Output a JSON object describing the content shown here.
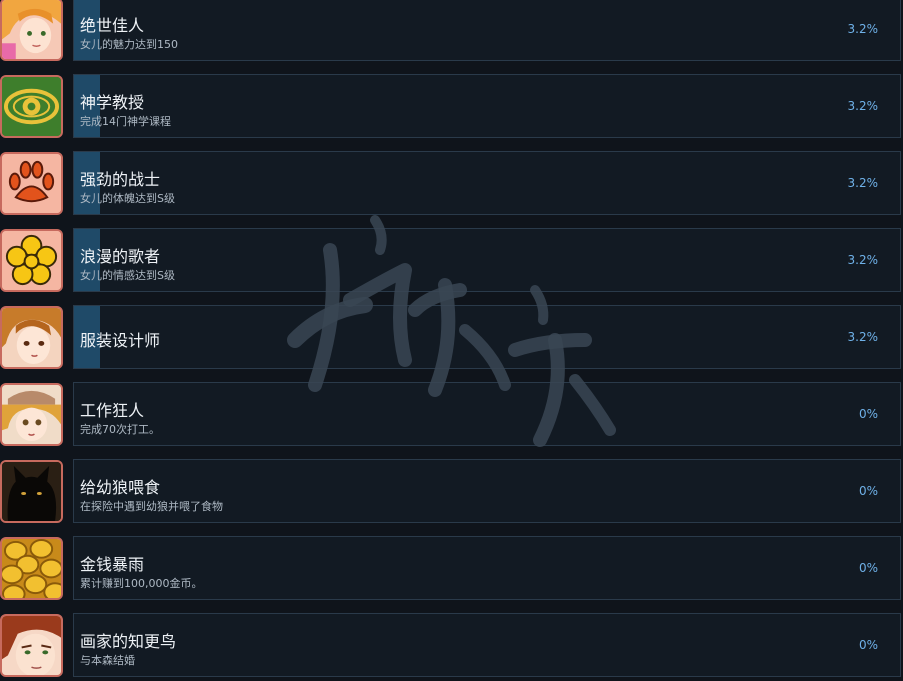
{
  "achievements": [
    {
      "title": "绝世佳人",
      "desc": "女儿的魅力达到150",
      "percent": "3.2%",
      "progress": 0.032,
      "icon": "blonde-girl-icon"
    },
    {
      "title": "神学教授",
      "desc": "完成14门神学课程",
      "percent": "3.2%",
      "progress": 0.032,
      "icon": "eye-icon"
    },
    {
      "title": "强劲的战士",
      "desc": "女儿的体魄达到S级",
      "percent": "3.2%",
      "progress": 0.032,
      "icon": "paw-icon"
    },
    {
      "title": "浪漫的歌者",
      "desc": "女儿的情感达到S级",
      "percent": "3.2%",
      "progress": 0.032,
      "icon": "flower-icon"
    },
    {
      "title": "服装设计师",
      "desc": "",
      "percent": "3.2%",
      "progress": 0.032,
      "icon": "girl-hair-bun-icon"
    },
    {
      "title": "工作狂人",
      "desc": "完成70次打工。",
      "percent": "0%",
      "progress": 0,
      "icon": "girl-cap-icon"
    },
    {
      "title": "给幼狼喂食",
      "desc": "在探险中遇到幼狼并喂了食物",
      "percent": "0%",
      "progress": 0,
      "icon": "black-wolf-icon"
    },
    {
      "title": "金钱暴雨",
      "desc": "累计赚到100,000金币。",
      "percent": "0%",
      "progress": 0,
      "icon": "gold-coins-icon"
    },
    {
      "title": "画家的知更鸟",
      "desc": "与本森结婚",
      "percent": "0%",
      "progress": 0,
      "icon": "redhead-man-icon"
    }
  ],
  "colors": {
    "background": "#0f141b",
    "card": "#121a23",
    "card_border": "#2a3a4a",
    "progress_fill": "#1f4a68",
    "percent_text": "#6fb1e8"
  }
}
